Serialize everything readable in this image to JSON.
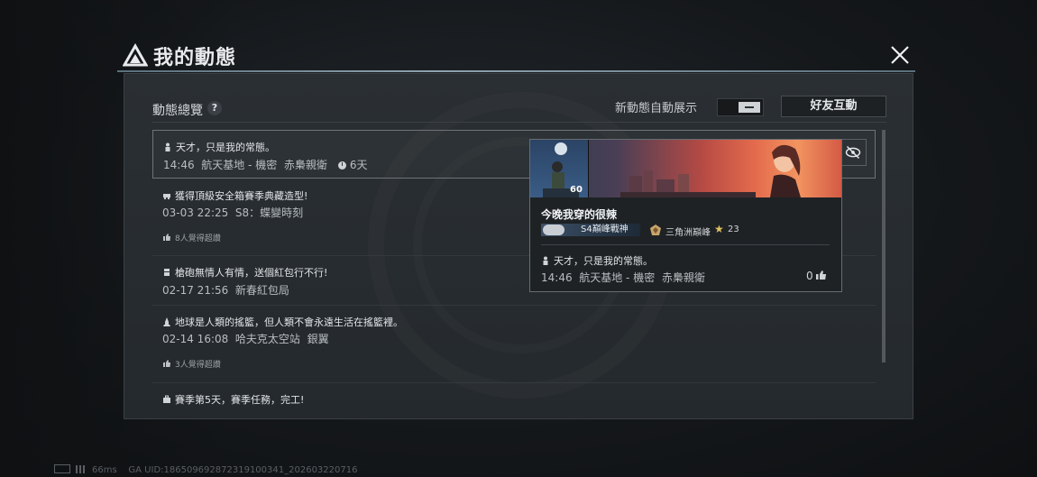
{
  "header": {
    "title": "我的動態"
  },
  "controls": {
    "overview_label": "動態總覽",
    "help_symbol": "?",
    "auto_show_label": "新動態自動展示",
    "friend_button": "好友互動"
  },
  "items": [
    {
      "icon": "person-icon",
      "text": "天才，只是我的常態。",
      "time": "14:46",
      "location": "航天基地 - 機密",
      "extra": "赤梟親衛",
      "duration": "6天"
    },
    {
      "icon": "vehicle-icon",
      "text": "獲得頂級安全箱賽季典藏造型!",
      "time": "03-03 22:25",
      "location": "S8：蝶變時刻",
      "likes": "8人覺得超讚"
    },
    {
      "icon": "redpacket-icon",
      "text": "槍砲無情人有情，送個紅包行不行!",
      "time": "02-17 21:56",
      "location": "新春紅包局"
    },
    {
      "icon": "rocket-icon",
      "text": "地球是人類的搖籃，但人類不會永遠生活在搖籃裡。",
      "time": "02-14 16:08",
      "location": "哈夫克太空站",
      "extra": "銀翼",
      "likes": "3人覺得超讚"
    },
    {
      "icon": "briefcase-icon",
      "text": "賽季第5天，賽季任務，完工!"
    }
  ],
  "card": {
    "level": "60",
    "name": "今晚我穿的很辣",
    "badge_rank": "S4巔峰戰神",
    "badge_title": "三角洲巔峰",
    "star_count": "23",
    "text": "天才，只是我的常態。",
    "time": "14:46",
    "location": "航天基地 - 機密",
    "extra": "赤梟親衛",
    "like_count": "0"
  },
  "footer": {
    "ping": "66ms",
    "uid": "GA UID:1865096928723191003​41_202603220716"
  },
  "colors": {
    "accent_line": "#8fa3ae",
    "panel_bg": "#2a2f33",
    "banner_warm": "#e36a4c"
  }
}
